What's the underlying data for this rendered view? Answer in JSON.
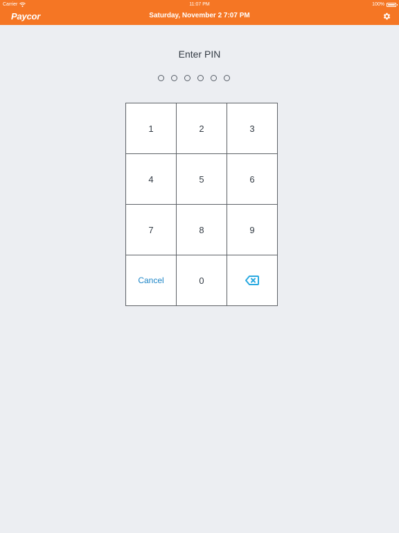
{
  "status_bar": {
    "carrier": "Carrier",
    "time": "11:07 PM",
    "battery_text": "100%",
    "battery_level": 1.0
  },
  "header": {
    "logo_text": "Paycor",
    "datetime": "Saturday, November 2  7:07 PM",
    "settings_icon": "gear-icon",
    "bar_color": "#f57624"
  },
  "pin": {
    "prompt": "Enter PIN",
    "length": 6,
    "entered": 0
  },
  "keypad": {
    "keys": [
      "1",
      "2",
      "3",
      "4",
      "5",
      "6",
      "7",
      "8",
      "9"
    ],
    "cancel_label": "Cancel",
    "zero_label": "0",
    "backspace_icon": "backspace-icon",
    "accent_color": "#1c85c7",
    "backspace_color": "#29a9e0"
  }
}
